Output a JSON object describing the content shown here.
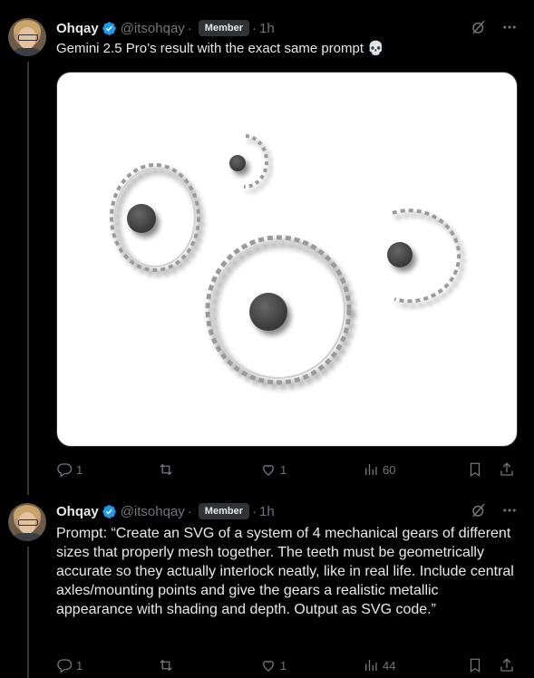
{
  "tweets": [
    {
      "author": "Ohqay",
      "handle": "@itsohqay",
      "badge": "Member",
      "separator": "·",
      "time": "1h",
      "text": "Gemini 2.5 Pro’s result with the exact same prompt 💀",
      "replies": "1",
      "retweets": "",
      "likes": "1",
      "views": "60"
    },
    {
      "author": "Ohqay",
      "handle": "@itsohqay",
      "badge": "Member",
      "separator": "·",
      "time": "1h",
      "text": "Prompt: “Create an SVG of a system of 4 mechanical gears of different sizes that properly mesh together. The teeth must be geometrically accurate so they actually interlock neatly, like in real life. Include central axles/mounting points and give the gears a realistic metallic appearance with shading and depth. Output as SVG code.”",
      "replies": "1",
      "retweets": "",
      "likes": "1",
      "views": "44"
    }
  ],
  "colors": {
    "verified": "#1d9bf0",
    "muted": "#71767b",
    "text": "#e7e9ea",
    "bg": "#000000"
  },
  "icons": [
    "verified-icon",
    "grok-icon",
    "more-icon",
    "reply-icon",
    "retweet-icon",
    "like-icon",
    "views-icon",
    "bookmark-icon",
    "share-icon"
  ]
}
